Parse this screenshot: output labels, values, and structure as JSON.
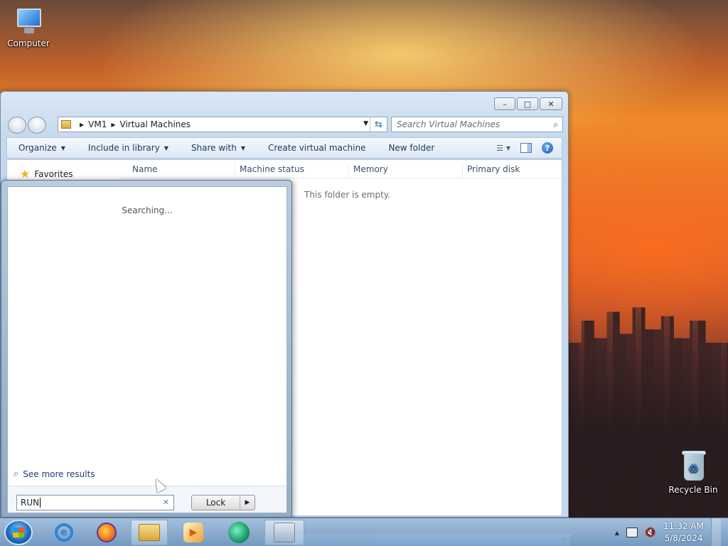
{
  "desktop": {
    "icons": [
      {
        "label": "Computer"
      },
      {
        "label": "Recycle Bin"
      }
    ]
  },
  "explorer": {
    "window_controls": {
      "minimize": "–",
      "maximize": "□",
      "close": "✕"
    },
    "address": {
      "crumbs": [
        "VM1",
        "Virtual Machines"
      ]
    },
    "search": {
      "placeholder": "Search Virtual Machines"
    },
    "toolbar": {
      "organize": "Organize",
      "include_in_library": "Include in library",
      "share_with": "Share with",
      "create_vm": "Create virtual machine",
      "new_folder": "New folder"
    },
    "nav_pane": {
      "favorites": "Favorites"
    },
    "columns": [
      "Name",
      "Machine status",
      "Memory",
      "Primary disk"
    ],
    "empty_message": "This folder is empty."
  },
  "start_menu": {
    "status": "Searching...",
    "see_more": "See more results",
    "search_value": "RUN",
    "lock_button": "Lock"
  },
  "taskbar": {
    "apps": [
      "internet-explorer",
      "firefox",
      "windows-explorer",
      "media-player",
      "green-app",
      "network-app"
    ],
    "clock": {
      "time": "11:32 AM",
      "date": "5/8/2024"
    }
  }
}
